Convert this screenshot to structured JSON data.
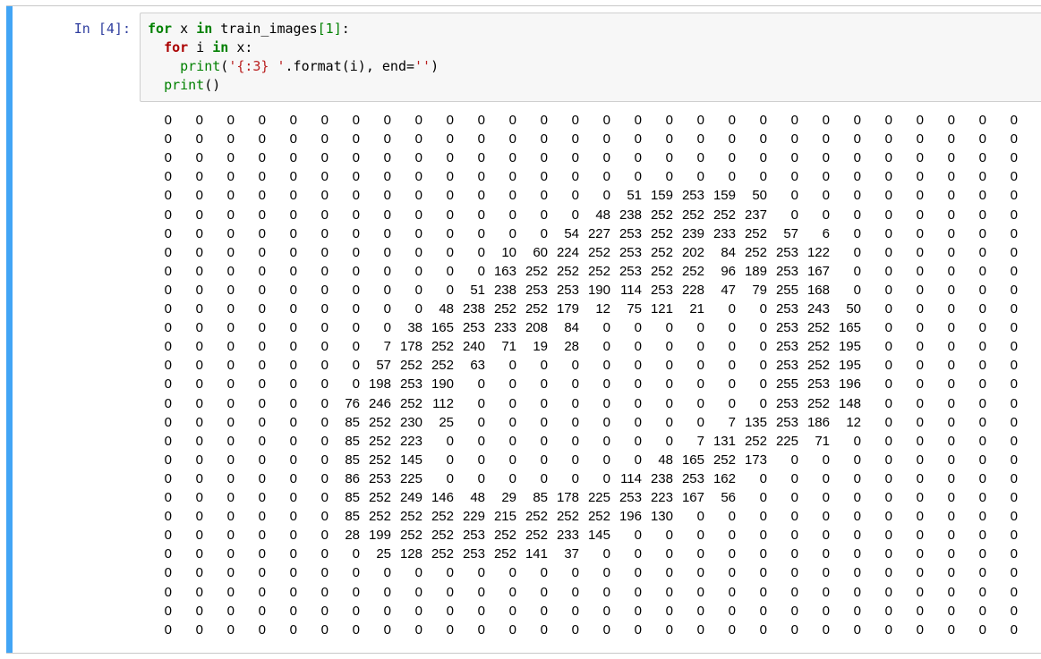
{
  "cell": {
    "prompt": "In [4]:",
    "code": [
      [
        {
          "t": "for",
          "c": "kw"
        },
        {
          "t": " x ",
          "c": ""
        },
        {
          "t": "in",
          "c": "kw"
        },
        {
          "t": " train_images",
          "c": ""
        },
        {
          "t": "[1]",
          "c": "num"
        },
        {
          "t": ":",
          "c": ""
        }
      ],
      [
        {
          "t": "  ",
          "c": ""
        },
        {
          "t": "for",
          "c": "kw-for2"
        },
        {
          "t": " i ",
          "c": ""
        },
        {
          "t": "in",
          "c": "kw"
        },
        {
          "t": " x:",
          "c": ""
        }
      ],
      [
        {
          "t": "    ",
          "c": ""
        },
        {
          "t": "print",
          "c": "bi"
        },
        {
          "t": "(",
          "c": ""
        },
        {
          "t": "'{:3} '",
          "c": "str"
        },
        {
          "t": ".format(i), end=",
          "c": ""
        },
        {
          "t": "''",
          "c": "str"
        },
        {
          "t": ")",
          "c": ""
        }
      ],
      [
        {
          "t": "  ",
          "c": ""
        },
        {
          "t": "print",
          "c": "bi"
        },
        {
          "t": "()",
          "c": ""
        }
      ]
    ]
  },
  "output": {
    "rows": [
      [
        0,
        0,
        0,
        0,
        0,
        0,
        0,
        0,
        0,
        0,
        0,
        0,
        0,
        0,
        0,
        0,
        0,
        0,
        0,
        0,
        0,
        0,
        0,
        0,
        0,
        0,
        0,
        0
      ],
      [
        0,
        0,
        0,
        0,
        0,
        0,
        0,
        0,
        0,
        0,
        0,
        0,
        0,
        0,
        0,
        0,
        0,
        0,
        0,
        0,
        0,
        0,
        0,
        0,
        0,
        0,
        0,
        0
      ],
      [
        0,
        0,
        0,
        0,
        0,
        0,
        0,
        0,
        0,
        0,
        0,
        0,
        0,
        0,
        0,
        0,
        0,
        0,
        0,
        0,
        0,
        0,
        0,
        0,
        0,
        0,
        0,
        0
      ],
      [
        0,
        0,
        0,
        0,
        0,
        0,
        0,
        0,
        0,
        0,
        0,
        0,
        0,
        0,
        0,
        0,
        0,
        0,
        0,
        0,
        0,
        0,
        0,
        0,
        0,
        0,
        0,
        0
      ],
      [
        0,
        0,
        0,
        0,
        0,
        0,
        0,
        0,
        0,
        0,
        0,
        0,
        0,
        0,
        0,
        51,
        159,
        253,
        159,
        50,
        0,
        0,
        0,
        0,
        0,
        0,
        0,
        0
      ],
      [
        0,
        0,
        0,
        0,
        0,
        0,
        0,
        0,
        0,
        0,
        0,
        0,
        0,
        0,
        48,
        238,
        252,
        252,
        252,
        237,
        0,
        0,
        0,
        0,
        0,
        0,
        0,
        0
      ],
      [
        0,
        0,
        0,
        0,
        0,
        0,
        0,
        0,
        0,
        0,
        0,
        0,
        0,
        54,
        227,
        253,
        252,
        239,
        233,
        252,
        57,
        6,
        0,
        0,
        0,
        0,
        0,
        0
      ],
      [
        0,
        0,
        0,
        0,
        0,
        0,
        0,
        0,
        0,
        0,
        0,
        10,
        60,
        224,
        252,
        253,
        252,
        202,
        84,
        252,
        253,
        122,
        0,
        0,
        0,
        0,
        0,
        0
      ],
      [
        0,
        0,
        0,
        0,
        0,
        0,
        0,
        0,
        0,
        0,
        0,
        163,
        252,
        252,
        252,
        253,
        252,
        252,
        96,
        189,
        253,
        167,
        0,
        0,
        0,
        0,
        0,
        0
      ],
      [
        0,
        0,
        0,
        0,
        0,
        0,
        0,
        0,
        0,
        0,
        51,
        238,
        253,
        253,
        190,
        114,
        253,
        228,
        47,
        79,
        255,
        168,
        0,
        0,
        0,
        0,
        0,
        0
      ],
      [
        0,
        0,
        0,
        0,
        0,
        0,
        0,
        0,
        0,
        48,
        238,
        252,
        252,
        179,
        12,
        75,
        121,
        21,
        0,
        0,
        253,
        243,
        50,
        0,
        0,
        0,
        0,
        0
      ],
      [
        0,
        0,
        0,
        0,
        0,
        0,
        0,
        0,
        38,
        165,
        253,
        233,
        208,
        84,
        0,
        0,
        0,
        0,
        0,
        0,
        253,
        252,
        165,
        0,
        0,
        0,
        0,
        0
      ],
      [
        0,
        0,
        0,
        0,
        0,
        0,
        0,
        7,
        178,
        252,
        240,
        71,
        19,
        28,
        0,
        0,
        0,
        0,
        0,
        0,
        253,
        252,
        195,
        0,
        0,
        0,
        0,
        0
      ],
      [
        0,
        0,
        0,
        0,
        0,
        0,
        0,
        57,
        252,
        252,
        63,
        0,
        0,
        0,
        0,
        0,
        0,
        0,
        0,
        0,
        253,
        252,
        195,
        0,
        0,
        0,
        0,
        0
      ],
      [
        0,
        0,
        0,
        0,
        0,
        0,
        0,
        198,
        253,
        190,
        0,
        0,
        0,
        0,
        0,
        0,
        0,
        0,
        0,
        0,
        255,
        253,
        196,
        0,
        0,
        0,
        0,
        0
      ],
      [
        0,
        0,
        0,
        0,
        0,
        0,
        76,
        246,
        252,
        112,
        0,
        0,
        0,
        0,
        0,
        0,
        0,
        0,
        0,
        0,
        253,
        252,
        148,
        0,
        0,
        0,
        0,
        0
      ],
      [
        0,
        0,
        0,
        0,
        0,
        0,
        85,
        252,
        230,
        25,
        0,
        0,
        0,
        0,
        0,
        0,
        0,
        0,
        7,
        135,
        253,
        186,
        12,
        0,
        0,
        0,
        0,
        0
      ],
      [
        0,
        0,
        0,
        0,
        0,
        0,
        85,
        252,
        223,
        0,
        0,
        0,
        0,
        0,
        0,
        0,
        0,
        7,
        131,
        252,
        225,
        71,
        0,
        0,
        0,
        0,
        0,
        0
      ],
      [
        0,
        0,
        0,
        0,
        0,
        0,
        85,
        252,
        145,
        0,
        0,
        0,
        0,
        0,
        0,
        0,
        48,
        165,
        252,
        173,
        0,
        0,
        0,
        0,
        0,
        0,
        0,
        0
      ],
      [
        0,
        0,
        0,
        0,
        0,
        0,
        86,
        253,
        225,
        0,
        0,
        0,
        0,
        0,
        0,
        114,
        238,
        253,
        162,
        0,
        0,
        0,
        0,
        0,
        0,
        0,
        0,
        0
      ],
      [
        0,
        0,
        0,
        0,
        0,
        0,
        85,
        252,
        249,
        146,
        48,
        29,
        85,
        178,
        225,
        253,
        223,
        167,
        56,
        0,
        0,
        0,
        0,
        0,
        0,
        0,
        0,
        0
      ],
      [
        0,
        0,
        0,
        0,
        0,
        0,
        85,
        252,
        252,
        252,
        229,
        215,
        252,
        252,
        252,
        196,
        130,
        0,
        0,
        0,
        0,
        0,
        0,
        0,
        0,
        0,
        0,
        0
      ],
      [
        0,
        0,
        0,
        0,
        0,
        0,
        28,
        199,
        252,
        252,
        253,
        252,
        252,
        233,
        145,
        0,
        0,
        0,
        0,
        0,
        0,
        0,
        0,
        0,
        0,
        0,
        0,
        0
      ],
      [
        0,
        0,
        0,
        0,
        0,
        0,
        0,
        25,
        128,
        252,
        253,
        252,
        141,
        37,
        0,
        0,
        0,
        0,
        0,
        0,
        0,
        0,
        0,
        0,
        0,
        0,
        0,
        0
      ],
      [
        0,
        0,
        0,
        0,
        0,
        0,
        0,
        0,
        0,
        0,
        0,
        0,
        0,
        0,
        0,
        0,
        0,
        0,
        0,
        0,
        0,
        0,
        0,
        0,
        0,
        0,
        0,
        0
      ],
      [
        0,
        0,
        0,
        0,
        0,
        0,
        0,
        0,
        0,
        0,
        0,
        0,
        0,
        0,
        0,
        0,
        0,
        0,
        0,
        0,
        0,
        0,
        0,
        0,
        0,
        0,
        0,
        0
      ],
      [
        0,
        0,
        0,
        0,
        0,
        0,
        0,
        0,
        0,
        0,
        0,
        0,
        0,
        0,
        0,
        0,
        0,
        0,
        0,
        0,
        0,
        0,
        0,
        0,
        0,
        0,
        0,
        0
      ],
      [
        0,
        0,
        0,
        0,
        0,
        0,
        0,
        0,
        0,
        0,
        0,
        0,
        0,
        0,
        0,
        0,
        0,
        0,
        0,
        0,
        0,
        0,
        0,
        0,
        0,
        0,
        0,
        0
      ]
    ]
  }
}
